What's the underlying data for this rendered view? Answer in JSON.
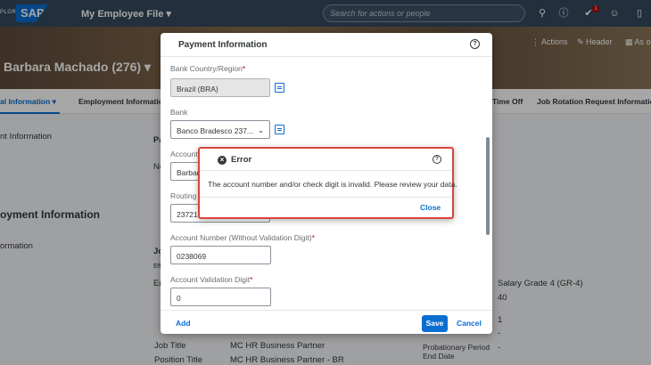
{
  "shell": {
    "brand_prefix": "PLORE",
    "logo": "SAP",
    "app_title": "My Employee File",
    "search_placeholder": "Search for actions or people",
    "notification_count": "1",
    "icons": [
      "search-icon",
      "help-icon",
      "notifications-icon",
      "people-icon",
      "book-icon"
    ]
  },
  "header": {
    "employee_name": "Barbara Machado (276)",
    "actions_label": "Actions",
    "header_label": "Header",
    "as_of_label": "As o"
  },
  "tabs": [
    "al Information",
    "Employment Informatio",
    "Time Off",
    "Job Rotation Request Informatio"
  ],
  "background": {
    "section1": "nt Information",
    "col_pa": "Pa",
    "col_no": "No",
    "section_employment": "oyment Information",
    "job_info": "ormation",
    "jo": "Jo",
    "eff": "Eff",
    "em": "Em",
    "job_title_lbl": "Job Title",
    "job_title_val": "MC HR Business Partner",
    "position_title_lbl": "Position Title",
    "position_title_val": "MC HR Business Partner - BR",
    "salary_grade": "Salary Grade 4 (GR-4)",
    "forty": "40",
    "one": "1",
    "dash1": "-",
    "dash2": "-",
    "probation_lbl": "Probationary Period End Date",
    "dash3": "-"
  },
  "payment_dialog": {
    "title": "Payment Information",
    "bank_country_label": "Bank Country/Region",
    "bank_country_value": "Brazil (BRA)",
    "bank_label": "Bank",
    "bank_value": "Banco Bradesco 237...",
    "account_owner_label": "Account",
    "account_owner_value": "Barbar",
    "routing_label": "Routing",
    "routing_value": "237214",
    "account_number_label": "Account Number (Without Validation Digit)",
    "account_number_value": "0238069",
    "validation_digit_label": "Account Validation Digit",
    "validation_digit_value": "0",
    "add_label": "Add",
    "save_label": "Save",
    "cancel_label": "Cancel"
  },
  "error_dialog": {
    "title": "Error",
    "message": "The account number and/or check digit is invalid. Please review your data.",
    "close_label": "Close"
  },
  "colors": {
    "shell": "#354a5f",
    "accent": "#0a6ed1",
    "error_border": "#d9443a",
    "required": "#bb0000"
  }
}
